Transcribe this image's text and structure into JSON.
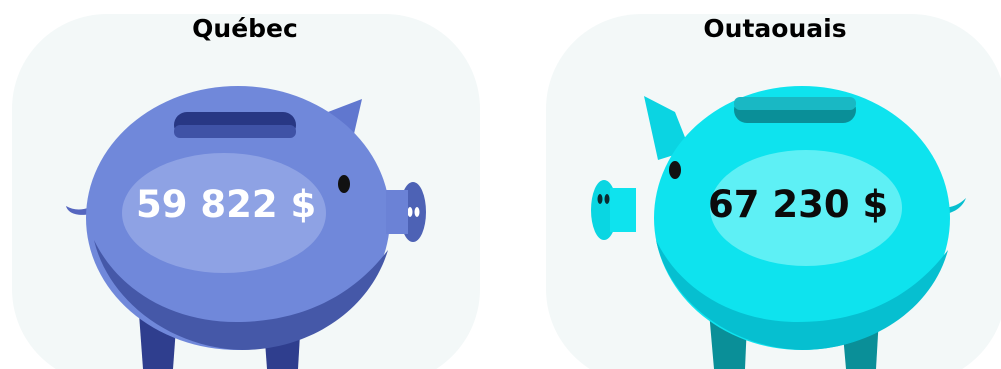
{
  "panels": [
    {
      "region": "Québec",
      "amount": "59 822 $",
      "body_color": "#7088da",
      "shade_color": "#4558a8",
      "leg_color": "#2f3e8e"
    },
    {
      "region": "Outaouais",
      "amount": "67 230 $",
      "body_color": "#0ee3ee",
      "shade_color": "#06bfd0",
      "leg_color": "#0a8f98"
    }
  ],
  "background_blob_color": "#f3f8f8",
  "icons": [
    "piggy-bank-icon",
    "piggy-bank-icon"
  ]
}
